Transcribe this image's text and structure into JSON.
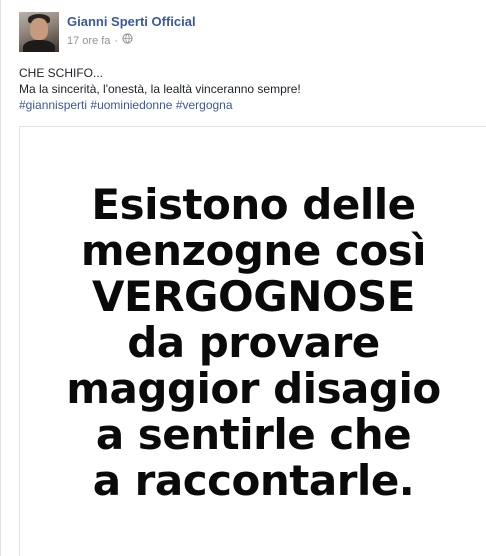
{
  "post": {
    "author": "Gianni Sperti Official",
    "timestamp": "17 ore fa",
    "separator": "·",
    "privacy_icon": "globe-icon",
    "caption_lines": [
      "CHE SCHIFO...",
      "Ma la sincerità, l'onestà, la lealtà vinceranno sempre!"
    ],
    "hashtags": [
      "#giannisperti",
      "#uominiedonne",
      "#vergogna"
    ],
    "image_text_lines": [
      "Esistono delle",
      "menzogne così",
      "VERGOGNOSE",
      "da provare",
      "maggior disagio",
      "a sentirle che",
      "a raccontarle."
    ]
  },
  "colors": {
    "link": "#3b5998",
    "meta": "#90949c",
    "text": "#1d2129",
    "quote_text": "#0a0a0a"
  }
}
